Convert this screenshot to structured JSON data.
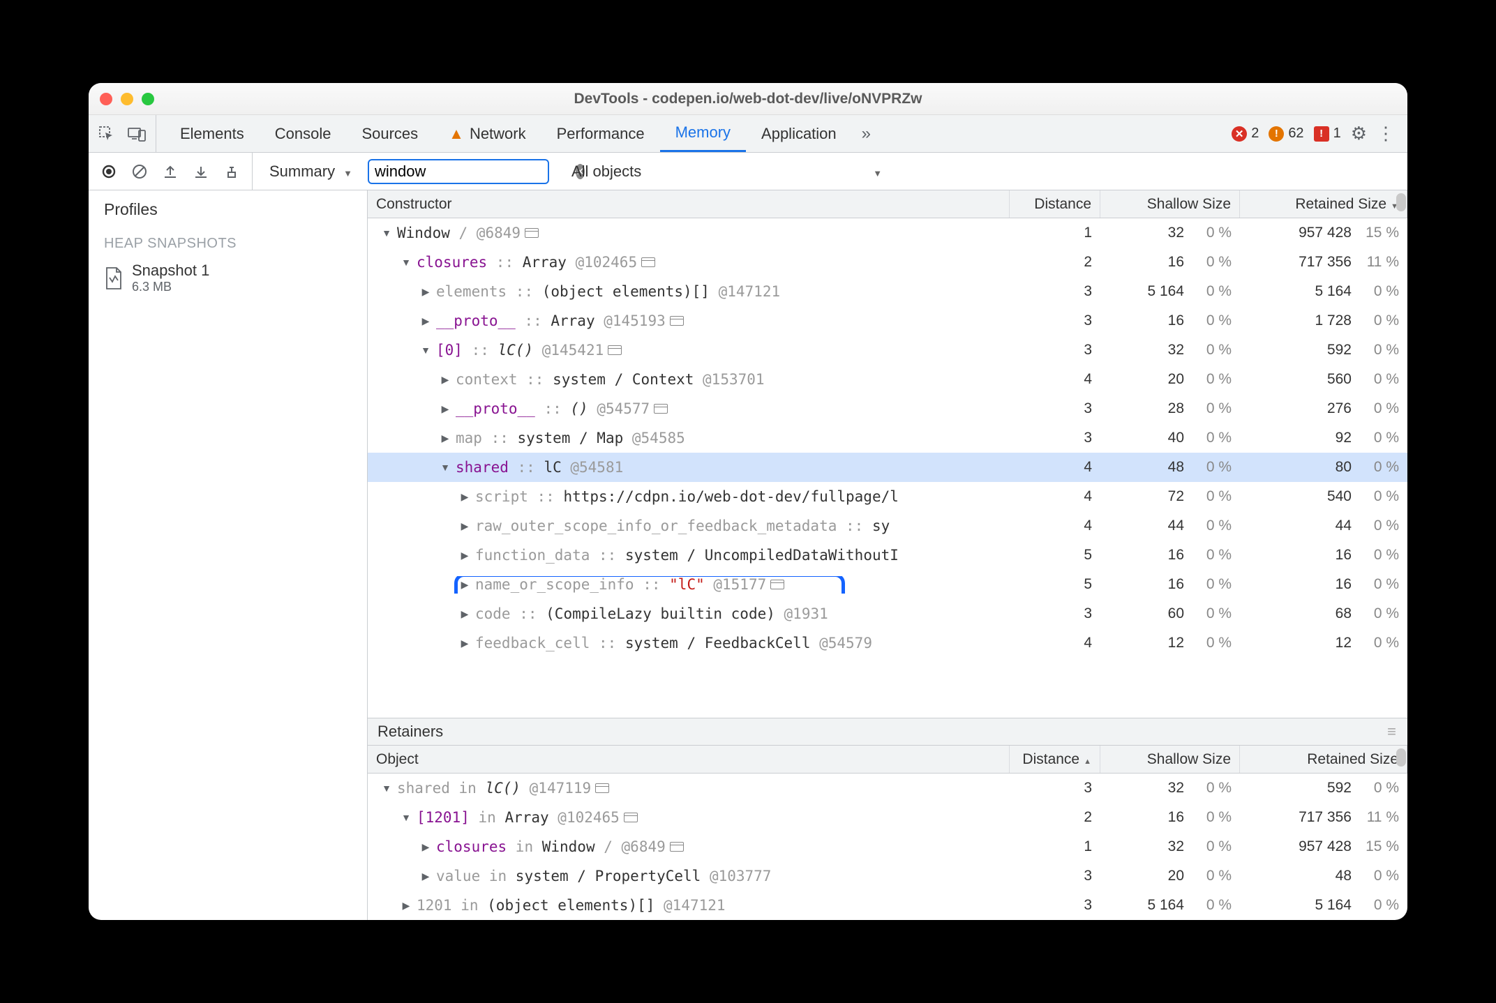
{
  "window": {
    "title": "DevTools - codepen.io/web-dot-dev/live/oNVPRZw"
  },
  "tabs": {
    "items": [
      "Elements",
      "Console",
      "Sources",
      "Network",
      "Performance",
      "Memory",
      "Application"
    ],
    "active": "Memory",
    "warn_on": "Network",
    "more": "»"
  },
  "counters": {
    "errors": "2",
    "warnings": "62",
    "issues": "1"
  },
  "toolbar": {
    "view": "Summary",
    "filter_value": "window",
    "scope": "All objects"
  },
  "sidebar": {
    "title": "Profiles",
    "section": "HEAP SNAPSHOTS",
    "snapshot": {
      "name": "Snapshot 1",
      "size": "6.3 MB"
    }
  },
  "columns": {
    "constructor": "Constructor",
    "distance": "Distance",
    "shallow": "Shallow Size",
    "retained": "Retained Size"
  },
  "rows": [
    {
      "d": 0,
      "tog": "▼",
      "segs": [
        {
          "t": "Window",
          "c": "objname"
        },
        {
          "t": " / ",
          "c": "sep"
        },
        {
          "t": "  @6849",
          "c": "addr"
        },
        {
          "wi": 1
        }
      ],
      "dist": "1",
      "sh": "32",
      "shp": "0 %",
      "rt": "957 428",
      "rtp": "15 %"
    },
    {
      "d": 1,
      "tog": "▼",
      "segs": [
        {
          "t": "closures",
          "c": "purple"
        },
        {
          "t": " :: ",
          "c": "sep"
        },
        {
          "t": "Array ",
          "c": "objname"
        },
        {
          "t": "@102465",
          "c": "addr"
        },
        {
          "wi": 1
        }
      ],
      "dist": "2",
      "sh": "16",
      "shp": "0 %",
      "rt": "717 356",
      "rtp": "11 %"
    },
    {
      "d": 2,
      "tog": "▶",
      "segs": [
        {
          "t": "elements",
          "c": "prop"
        },
        {
          "t": " :: ",
          "c": "sep"
        },
        {
          "t": "(object elements)[] ",
          "c": "objname"
        },
        {
          "t": "@147121",
          "c": "addr"
        }
      ],
      "dist": "3",
      "sh": "5 164",
      "shp": "0 %",
      "rt": "5 164",
      "rtp": "0 %"
    },
    {
      "d": 2,
      "tog": "▶",
      "segs": [
        {
          "t": "__proto__",
          "c": "purple"
        },
        {
          "t": " :: ",
          "c": "sep"
        },
        {
          "t": "Array ",
          "c": "objname"
        },
        {
          "t": "@145193",
          "c": "addr"
        },
        {
          "wi": 1
        }
      ],
      "dist": "3",
      "sh": "16",
      "shp": "0 %",
      "rt": "1 728",
      "rtp": "0 %"
    },
    {
      "d": 2,
      "tog": "▼",
      "segs": [
        {
          "t": "[0]",
          "c": "purple"
        },
        {
          "t": " :: ",
          "c": "sep"
        },
        {
          "t": "lC()",
          "c": "objname italic"
        },
        {
          "t": " @145421",
          "c": "addr"
        },
        {
          "wi": 1
        }
      ],
      "dist": "3",
      "sh": "32",
      "shp": "0 %",
      "rt": "592",
      "rtp": "0 %"
    },
    {
      "d": 3,
      "tog": "▶",
      "segs": [
        {
          "t": "context",
          "c": "prop"
        },
        {
          "t": " :: ",
          "c": "sep"
        },
        {
          "t": "system / Context ",
          "c": "objname"
        },
        {
          "t": "@153701",
          "c": "addr"
        }
      ],
      "dist": "4",
      "sh": "20",
      "shp": "0 %",
      "rt": "560",
      "rtp": "0 %"
    },
    {
      "d": 3,
      "tog": "▶",
      "segs": [
        {
          "t": "__proto__",
          "c": "purple"
        },
        {
          "t": " :: ",
          "c": "sep"
        },
        {
          "t": "()",
          "c": "objname italic"
        },
        {
          "t": " @54577",
          "c": "addr"
        },
        {
          "wi": 1
        }
      ],
      "dist": "3",
      "sh": "28",
      "shp": "0 %",
      "rt": "276",
      "rtp": "0 %"
    },
    {
      "d": 3,
      "tog": "▶",
      "segs": [
        {
          "t": "map",
          "c": "prop"
        },
        {
          "t": " :: ",
          "c": "sep"
        },
        {
          "t": "system / Map ",
          "c": "objname"
        },
        {
          "t": "@54585",
          "c": "addr"
        }
      ],
      "dist": "3",
      "sh": "40",
      "shp": "0 %",
      "rt": "92",
      "rtp": "0 %"
    },
    {
      "d": 3,
      "tog": "▼",
      "sel": true,
      "segs": [
        {
          "t": "shared",
          "c": "purple"
        },
        {
          "t": " :: ",
          "c": "sep"
        },
        {
          "t": "lC ",
          "c": "objname"
        },
        {
          "t": "@54581",
          "c": "addr"
        }
      ],
      "dist": "4",
      "sh": "48",
      "shp": "0 %",
      "rt": "80",
      "rtp": "0 %"
    },
    {
      "d": 4,
      "tog": "▶",
      "segs": [
        {
          "t": "script",
          "c": "prop"
        },
        {
          "t": " :: ",
          "c": "sep"
        },
        {
          "t": "https://cdpn.io/web-dot-dev/fullpage/l",
          "c": "objname"
        }
      ],
      "dist": "4",
      "sh": "72",
      "shp": "0 %",
      "rt": "540",
      "rtp": "0 %"
    },
    {
      "d": 4,
      "tog": "▶",
      "segs": [
        {
          "t": "raw_outer_scope_info_or_feedback_metadata",
          "c": "prop"
        },
        {
          "t": " :: ",
          "c": "sep"
        },
        {
          "t": "sy",
          "c": "objname"
        }
      ],
      "dist": "4",
      "sh": "44",
      "shp": "0 %",
      "rt": "44",
      "rtp": "0 %"
    },
    {
      "d": 4,
      "tog": "▶",
      "segs": [
        {
          "t": "function_data",
          "c": "prop"
        },
        {
          "t": " :: ",
          "c": "sep"
        },
        {
          "t": "system / UncompiledDataWithoutI",
          "c": "objname"
        }
      ],
      "dist": "5",
      "sh": "16",
      "shp": "0 %",
      "rt": "16",
      "rtp": "0 %"
    },
    {
      "d": 4,
      "tog": "▶",
      "hl": true,
      "segs": [
        {
          "t": "name_or_scope_info",
          "c": "prop"
        },
        {
          "t": " :: ",
          "c": "sep"
        },
        {
          "t": "\"lC\"",
          "c": "strv"
        },
        {
          "t": " @15177",
          "c": "addr"
        },
        {
          "wi": 1
        }
      ],
      "dist": "5",
      "sh": "16",
      "shp": "0 %",
      "rt": "16",
      "rtp": "0 %"
    },
    {
      "d": 4,
      "tog": "▶",
      "segs": [
        {
          "t": "code",
          "c": "prop"
        },
        {
          "t": " :: ",
          "c": "sep"
        },
        {
          "t": "(CompileLazy builtin code) ",
          "c": "objname"
        },
        {
          "t": "@1931",
          "c": "addr"
        }
      ],
      "dist": "3",
      "sh": "60",
      "shp": "0 %",
      "rt": "68",
      "rtp": "0 %"
    },
    {
      "d": 4,
      "tog": "▶",
      "segs": [
        {
          "t": "feedback_cell",
          "c": "prop"
        },
        {
          "t": " :: ",
          "c": "sep"
        },
        {
          "t": "system / FeedbackCell ",
          "c": "objname"
        },
        {
          "t": "@54579",
          "c": "addr"
        }
      ],
      "dist": "4",
      "sh": "12",
      "shp": "0 %",
      "rt": "12",
      "rtp": "0 %"
    }
  ],
  "retainers": {
    "title": "Retainers",
    "columns": {
      "object": "Object",
      "distance": "Distance",
      "shallow": "Shallow Size",
      "retained": "Retained Size"
    },
    "rows": [
      {
        "d": 0,
        "tog": "▼",
        "segs": [
          {
            "t": "shared",
            "c": "prop"
          },
          {
            "t": " in ",
            "c": "sep"
          },
          {
            "t": "lC()",
            "c": "objname italic"
          },
          {
            "t": " @147119",
            "c": "addr"
          },
          {
            "wi": 1
          }
        ],
        "dist": "3",
        "sh": "32",
        "shp": "0 %",
        "rt": "592",
        "rtp": "0 %"
      },
      {
        "d": 1,
        "tog": "▼",
        "segs": [
          {
            "t": "[1201]",
            "c": "purple"
          },
          {
            "t": " in ",
            "c": "sep"
          },
          {
            "t": "Array ",
            "c": "objname"
          },
          {
            "t": "@102465",
            "c": "addr"
          },
          {
            "wi": 1
          }
        ],
        "dist": "2",
        "sh": "16",
        "shp": "0 %",
        "rt": "717 356",
        "rtp": "11 %"
      },
      {
        "d": 2,
        "tog": "▶",
        "segs": [
          {
            "t": "closures",
            "c": "purple"
          },
          {
            "t": " in ",
            "c": "sep"
          },
          {
            "t": "Window ",
            "c": "objname"
          },
          {
            "t": "/  @6849",
            "c": "addr"
          },
          {
            "wi": 1
          }
        ],
        "dist": "1",
        "sh": "32",
        "shp": "0 %",
        "rt": "957 428",
        "rtp": "15 %"
      },
      {
        "d": 2,
        "tog": "▶",
        "segs": [
          {
            "t": "value",
            "c": "prop"
          },
          {
            "t": " in ",
            "c": "sep"
          },
          {
            "t": "system / PropertyCell ",
            "c": "objname"
          },
          {
            "t": "@103777",
            "c": "addr"
          }
        ],
        "dist": "3",
        "sh": "20",
        "shp": "0 %",
        "rt": "48",
        "rtp": "0 %"
      },
      {
        "d": 1,
        "tog": "▶",
        "segs": [
          {
            "t": "1201",
            "c": "prop"
          },
          {
            "t": " in ",
            "c": "sep"
          },
          {
            "t": "(object elements)[] ",
            "c": "objname"
          },
          {
            "t": "@147121",
            "c": "addr"
          }
        ],
        "dist": "3",
        "sh": "5 164",
        "shp": "0 %",
        "rt": "5 164",
        "rtp": "0 %"
      }
    ]
  }
}
